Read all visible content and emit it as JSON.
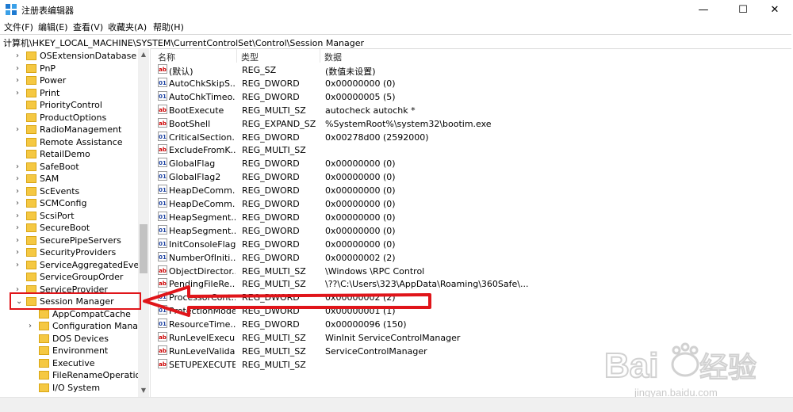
{
  "window": {
    "title": "注册表编辑器",
    "minimize": "—",
    "maximize": "☐",
    "close": "✕"
  },
  "menu": [
    "文件(F)",
    "编辑(E)",
    "查看(V)",
    "收藏夹(A)",
    "帮助(H)"
  ],
  "address": "计算机\\HKEY_LOCAL_MACHINE\\SYSTEM\\CurrentControlSet\\Control\\Session Manager",
  "tree": {
    "items": [
      {
        "label": "OSExtensionDatabase",
        "expand": "›"
      },
      {
        "label": "PnP",
        "expand": "›"
      },
      {
        "label": "Power",
        "expand": "›"
      },
      {
        "label": "Print",
        "expand": "›"
      },
      {
        "label": "PriorityControl",
        "expand": ""
      },
      {
        "label": "ProductOptions",
        "expand": ""
      },
      {
        "label": "RadioManagement",
        "expand": "›"
      },
      {
        "label": "Remote Assistance",
        "expand": ""
      },
      {
        "label": "RetailDemo",
        "expand": ""
      },
      {
        "label": "SafeBoot",
        "expand": "›"
      },
      {
        "label": "SAM",
        "expand": "›"
      },
      {
        "label": "ScEvents",
        "expand": "›"
      },
      {
        "label": "SCMConfig",
        "expand": "›"
      },
      {
        "label": "ScsiPort",
        "expand": "›"
      },
      {
        "label": "SecureBoot",
        "expand": "›"
      },
      {
        "label": "SecurePipeServers",
        "expand": "›"
      },
      {
        "label": "SecurityProviders",
        "expand": "›"
      },
      {
        "label": "ServiceAggregatedEven",
        "expand": "›"
      },
      {
        "label": "ServiceGroupOrder",
        "expand": ""
      },
      {
        "label": "ServiceProvider",
        "expand": "›"
      },
      {
        "label": "Session Manager",
        "expand": "⌄"
      },
      {
        "label": "AppCompatCache",
        "expand": ""
      },
      {
        "label": "Configuration Manage",
        "expand": "›"
      },
      {
        "label": "DOS Devices",
        "expand": ""
      },
      {
        "label": "Environment",
        "expand": ""
      },
      {
        "label": "Executive",
        "expand": ""
      },
      {
        "label": "FileRenameOperation",
        "expand": ""
      },
      {
        "label": "I/O System",
        "expand": ""
      }
    ]
  },
  "list": {
    "headers": {
      "name": "名称",
      "type": "类型",
      "data": "数据"
    },
    "rows": [
      {
        "name": "(默认)",
        "type": "REG_SZ",
        "data": "(数值未设置)",
        "icon": "ab"
      },
      {
        "name": "AutoChkSkipS...",
        "type": "REG_DWORD",
        "data": "0x00000000 (0)",
        "icon": "01"
      },
      {
        "name": "AutoChkTimeo...",
        "type": "REG_DWORD",
        "data": "0x00000005 (5)",
        "icon": "01"
      },
      {
        "name": "BootExecute",
        "type": "REG_MULTI_SZ",
        "data": "autocheck autochk *",
        "icon": "ab"
      },
      {
        "name": "BootShell",
        "type": "REG_EXPAND_SZ",
        "data": "%SystemRoot%\\system32\\bootim.exe",
        "icon": "ab"
      },
      {
        "name": "CriticalSection...",
        "type": "REG_DWORD",
        "data": "0x00278d00 (2592000)",
        "icon": "01"
      },
      {
        "name": "ExcludeFromK...",
        "type": "REG_MULTI_SZ",
        "data": "",
        "icon": "ab"
      },
      {
        "name": "GlobalFlag",
        "type": "REG_DWORD",
        "data": "0x00000000 (0)",
        "icon": "01"
      },
      {
        "name": "GlobalFlag2",
        "type": "REG_DWORD",
        "data": "0x00000000 (0)",
        "icon": "01"
      },
      {
        "name": "HeapDeComm...",
        "type": "REG_DWORD",
        "data": "0x00000000 (0)",
        "icon": "01"
      },
      {
        "name": "HeapDeComm...",
        "type": "REG_DWORD",
        "data": "0x00000000 (0)",
        "icon": "01"
      },
      {
        "name": "HeapSegment...",
        "type": "REG_DWORD",
        "data": "0x00000000 (0)",
        "icon": "01"
      },
      {
        "name": "HeapSegment...",
        "type": "REG_DWORD",
        "data": "0x00000000 (0)",
        "icon": "01"
      },
      {
        "name": "InitConsoleFlags",
        "type": "REG_DWORD",
        "data": "0x00000000 (0)",
        "icon": "01"
      },
      {
        "name": "NumberOfIniti...",
        "type": "REG_DWORD",
        "data": "0x00000002 (2)",
        "icon": "01"
      },
      {
        "name": "ObjectDirector...",
        "type": "REG_MULTI_SZ",
        "data": "\\Windows \\RPC Control",
        "icon": "ab"
      },
      {
        "name": "PendingFileRe...",
        "type": "REG_MULTI_SZ",
        "data": "\\??\\C:\\Users\\323\\AppData\\Roaming\\360Safe\\...",
        "icon": "ab"
      },
      {
        "name": "ProcessorCont...",
        "type": "REG_DWORD",
        "data": "0x00000002 (2)",
        "icon": "01"
      },
      {
        "name": "ProtectionMode",
        "type": "REG_DWORD",
        "data": "0x00000001 (1)",
        "icon": "01"
      },
      {
        "name": "ResourceTime...",
        "type": "REG_DWORD",
        "data": "0x00000096 (150)",
        "icon": "01"
      },
      {
        "name": "RunLevelExecu...",
        "type": "REG_MULTI_SZ",
        "data": "WinInit ServiceControlManager",
        "icon": "ab"
      },
      {
        "name": "RunLevelValida...",
        "type": "REG_MULTI_SZ",
        "data": "ServiceControlManager",
        "icon": "ab"
      },
      {
        "name": "SETUPEXECUTE",
        "type": "REG_MULTI_SZ",
        "data": "",
        "icon": "ab"
      }
    ]
  },
  "watermark": {
    "brand": "Bai",
    "suffix": "经验",
    "url": "jingyan.baidu.com"
  },
  "colors": {
    "annotation": "#e0151a",
    "folder": "#f5c842"
  }
}
